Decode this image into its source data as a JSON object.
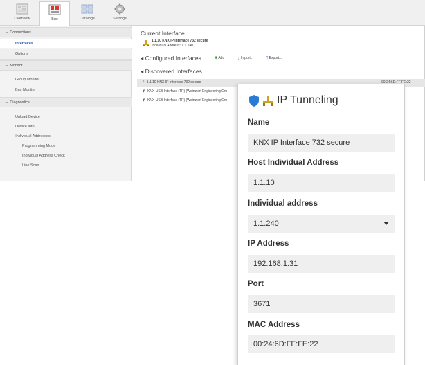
{
  "toolbar": {
    "tabs": [
      {
        "label": "Overview",
        "icon": "overview-icon"
      },
      {
        "label": "Bus",
        "icon": "bus-icon"
      },
      {
        "label": "Catalogs",
        "icon": "catalogs-icon"
      },
      {
        "label": "Settings",
        "icon": "gear-icon"
      }
    ],
    "active": "Bus"
  },
  "sidebar": {
    "connections": "Connections",
    "interfaces": "Interfaces",
    "options": "Options",
    "monitor": "Monitor",
    "group_monitor": "Group Monitor",
    "bus_monitor": "Bus Monitor",
    "diagnostics": "Diagnostics",
    "unload_device": "Unload Device",
    "device_info": "Device Info",
    "individual_addresses": "Individual Addresses",
    "programming_mode": "Programming Mode",
    "individual_address_check": "Individual Address Check",
    "line_scan": "Line Scan"
  },
  "content": {
    "current_interface_title": "Current Interface",
    "current_name": "1.1.10 KNX IP Interface 732 secure",
    "current_addr": "Individual Address: 1.1.240",
    "configured_title": "Configured Interfaces",
    "add": "Add",
    "import": "Import...",
    "export": "Export...",
    "discovered_title": "Discovered Interfaces",
    "discovered": [
      {
        "name": "1.1.10 KNX IP Interface 732 secure",
        "right": "00:24:6D:FF:FE:22"
      },
      {
        "name": "KNX-USB Interface (TP) (Weinzierl Engineering Gm",
        "right": ""
      },
      {
        "name": "KNX-USB Interface (TP) (Weinzierl Engineering Gm",
        "right": ""
      }
    ]
  },
  "panel": {
    "title": "IP Tunneling",
    "name_label": "Name",
    "name_value": "KNX IP Interface 732 secure",
    "host_label": "Host Individual Address",
    "host_value": "1.1.10",
    "indiv_label": "Individual address",
    "indiv_value": "1.1.240",
    "ip_label": "IP Address",
    "ip_value": "192.168.1.31",
    "port_label": "Port",
    "port_value": "3671",
    "mac_label": "MAC Address",
    "mac_value": "00:24:6D:FF:FE:22"
  },
  "colors": {
    "accent": "#1e5fa8",
    "shield": "#2a7bd4",
    "add_green": "#2f9a2f"
  }
}
